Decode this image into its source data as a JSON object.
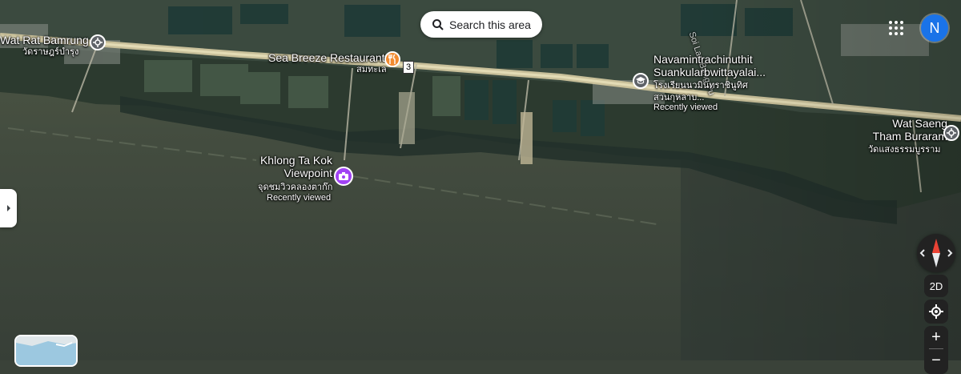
{
  "search": {
    "label": "Search this area"
  },
  "account": {
    "initial": "N",
    "color": "#1a73e8"
  },
  "places": [
    {
      "name": "Wat Rat Bamrung",
      "native": "วัดราษฎร์บำรุง",
      "note": "",
      "icon": "temple-icon"
    },
    {
      "name": "Sea Breeze Restaurant",
      "native": "สมทะเล",
      "note": "",
      "icon": "restaurant-icon"
    },
    {
      "name": "Navamintrachinuthit Suankularbwittayalai...",
      "native": "โรงเรียนนวมินทราชินูทิศ สวนกุหลาบ...",
      "note": "Recently viewed",
      "icon": "school-icon"
    },
    {
      "name": "Wat Saeng Tham Buraram",
      "native": "วัดแสงธรรมบูรราม",
      "note": "",
      "icon": "temple-icon"
    },
    {
      "name": "Khlong Ta Kok Viewpoint",
      "native": "จุดชมวิวคลองตาก๊ก",
      "note": "Recently viewed",
      "icon": "camera-icon"
    }
  ],
  "route_shield": "3",
  "road_label": "Soi Lan Bang Pu",
  "controls": {
    "view_mode": "2D",
    "zoom_in": "+",
    "zoom_out": "−"
  },
  "colors": {
    "restaurant": "#f28b30",
    "viewpoint": "#a142f4",
    "landmark": "#5f6368"
  }
}
